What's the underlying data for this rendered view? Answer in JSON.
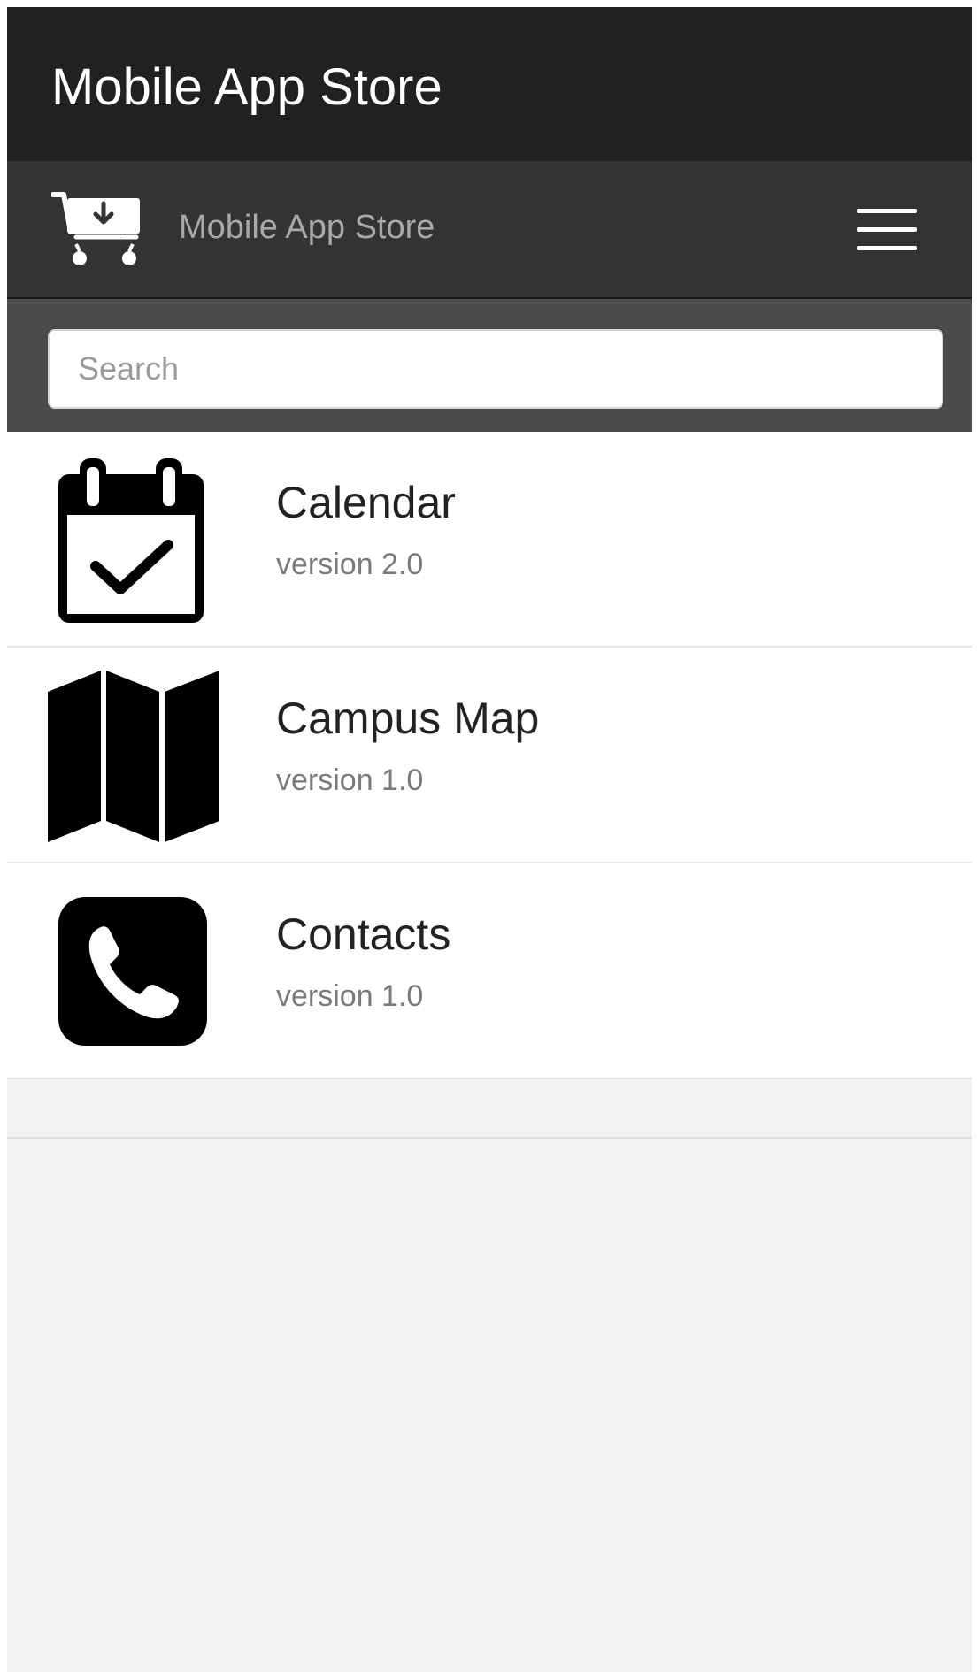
{
  "title_bar": {
    "title": "Mobile App Store"
  },
  "app_header": {
    "logo_icon": "shopping-cart-download-icon",
    "label": "Mobile App Store",
    "menu_icon": "hamburger-menu-icon"
  },
  "search": {
    "placeholder": "Search",
    "value": ""
  },
  "apps": [
    {
      "name": "Calendar",
      "version": "version 2.0",
      "icon": "calendar-check-icon"
    },
    {
      "name": "Campus Map",
      "version": "version 1.0",
      "icon": "folded-map-icon"
    },
    {
      "name": "Contacts",
      "version": "version 1.0",
      "icon": "phone-icon"
    }
  ],
  "colors": {
    "title_bar_bg": "#212121",
    "header_bg": "#333333",
    "search_band_bg": "#4b4b4b",
    "page_bg": "#f2f2f2",
    "header_label": "#a8a8a8",
    "version_text": "#7a7a7a"
  }
}
